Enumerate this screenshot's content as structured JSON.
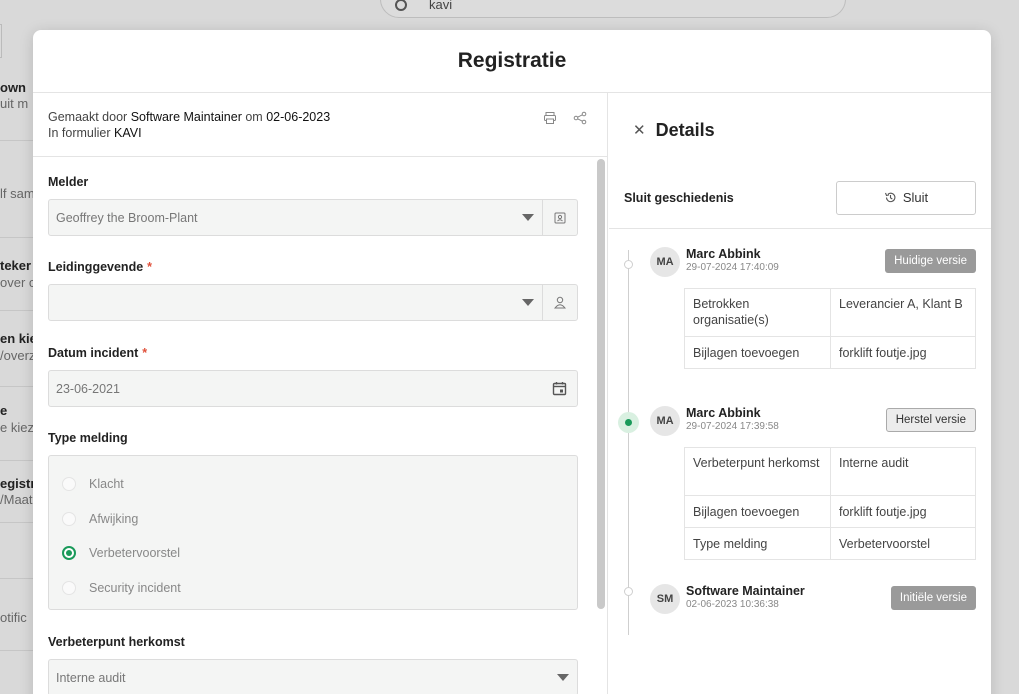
{
  "background": {
    "search_text": "kavi",
    "items": [
      {
        "text": "own",
        "style": "b"
      },
      {
        "text": "uit m",
        "style": "m"
      },
      {
        "text": "lf sam",
        "style": "m"
      },
      {
        "text": "teker",
        "style": "b"
      },
      {
        "text": "over c",
        "style": "m"
      },
      {
        "text": "en kiez",
        "style": "b"
      },
      {
        "text": "/overz",
        "style": "m"
      },
      {
        "text": "e",
        "style": "b"
      },
      {
        "text": "e kiez",
        "style": "m"
      },
      {
        "text": "egistra",
        "style": "b"
      },
      {
        "text": "/Maat",
        "style": "m"
      },
      {
        "text": "otific",
        "style": "m"
      }
    ]
  },
  "modal": {
    "title": "Registratie",
    "meta": {
      "made_by_prefix": "Gemaakt door",
      "author": "Software Maintainer",
      "on": "om",
      "date": "02-06-2023",
      "form_prefix": "In formulier",
      "form_name": "KAVI"
    },
    "form": {
      "melder": {
        "label": "Melder",
        "value": "Geoffrey the Broom-Plant"
      },
      "leidinggevende": {
        "label": "Leidinggevende",
        "required": "*",
        "value": ""
      },
      "datum": {
        "label": "Datum incident",
        "required": "*",
        "value": "23-06-2021"
      },
      "type_melding": {
        "label": "Type melding",
        "options": [
          "Klacht",
          "Afwijking",
          "Verbetervoorstel",
          "Security incident"
        ],
        "selected": "Verbetervoorstel"
      },
      "verbeterpunt": {
        "label": "Verbeterpunt herkomst",
        "value": "Interne audit"
      }
    },
    "details": {
      "title": "Details",
      "history_label": "Sluit geschiedenis",
      "history_button": "Sluit",
      "versions": [
        {
          "initials": "MA",
          "name": "Marc Abbink",
          "date": "29-07-2024 17:40:09",
          "badge": "Huidige versie",
          "changes": [
            {
              "field": "Betrokken organisatie(s)",
              "value": "Leverancier A, Klant B"
            },
            {
              "field": "Bijlagen toevoegen",
              "value": "forklift foutje.jpg"
            }
          ]
        },
        {
          "initials": "MA",
          "name": "Marc Abbink",
          "date": "29-07-2024 17:39:58",
          "badge": "Herstel versie",
          "changes": [
            {
              "field": "Verbeterpunt herkomst",
              "value": "Interne audit"
            },
            {
              "field": "Bijlagen toevoegen",
              "value": "forklift foutje.jpg"
            },
            {
              "field": "Type melding",
              "value": "Verbetervoorstel"
            }
          ]
        },
        {
          "initials": "SM",
          "name": "Software Maintainer",
          "date": "02-06-2023 10:36:38",
          "badge": "Initiële versie",
          "changes": []
        }
      ]
    }
  }
}
